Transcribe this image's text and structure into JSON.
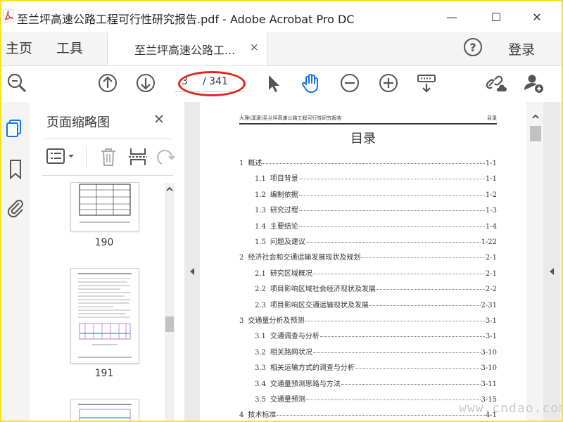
{
  "window": {
    "title": "至兰坪高速公路工程可行性研究报告.pdf - Adobe Acrobat Pro DC",
    "minimize": "—",
    "maximize": "☐",
    "close": "✕"
  },
  "tabs": {
    "home": "主页",
    "tools": "工具",
    "document": "至兰坪高速公路工...",
    "document_close": "×",
    "login": "登录"
  },
  "toolbar": {
    "current_page": "3",
    "page_total": "/ 341"
  },
  "panel": {
    "title": "页面缩略图",
    "close": "✕",
    "thumbnails": [
      {
        "page": "190"
      },
      {
        "page": "191"
      }
    ]
  },
  "document": {
    "header_left": "大理(漾濞)至兰坪高速公路工程可行性研究报告",
    "header_right": "目录",
    "toc_title": "目录",
    "toc": [
      {
        "num": "1",
        "title": "概述",
        "page": "1-1",
        "level": 1
      },
      {
        "num": "1.1",
        "title": "项目背景",
        "page": "1-1",
        "level": 2
      },
      {
        "num": "1.2",
        "title": "编制依据",
        "page": "1-2",
        "level": 2
      },
      {
        "num": "1.3",
        "title": "研究过程",
        "page": "1-3",
        "level": 2
      },
      {
        "num": "1.4",
        "title": "主要结论",
        "page": "1-4",
        "level": 2
      },
      {
        "num": "1.5",
        "title": "问题及建议",
        "page": "1-22",
        "level": 2
      },
      {
        "num": "2",
        "title": "经济社会和交通运输发展现状及规划",
        "page": "2-1",
        "level": 1
      },
      {
        "num": "2.1",
        "title": "研究区域概况",
        "page": "2-1",
        "level": 2
      },
      {
        "num": "2.2",
        "title": "项目影响区域社会经济现状及发展",
        "page": "2-2",
        "level": 2
      },
      {
        "num": "2.3",
        "title": "项目影响区交通运输现状及发展",
        "page": "2-31",
        "level": 2
      },
      {
        "num": "3",
        "title": "交通量分析及预测",
        "page": "3-1",
        "level": 1
      },
      {
        "num": "3.1",
        "title": "交通调查与分析",
        "page": "3-1",
        "level": 2
      },
      {
        "num": "3.2",
        "title": "相关路网状况",
        "page": "3-10",
        "level": 2
      },
      {
        "num": "3.3",
        "title": "相关运输方式的调查与分析",
        "page": "3-10",
        "level": 2
      },
      {
        "num": "3.4",
        "title": "交通量预测思路与方法",
        "page": "3-11",
        "level": 2
      },
      {
        "num": "3.5",
        "title": "交通量预测",
        "page": "3-15",
        "level": 2
      },
      {
        "num": "4",
        "title": "技术标准",
        "page": "4-1",
        "level": 1
      }
    ]
  },
  "watermark": "www.cndao.com",
  "colors": {
    "accent": "#1473e6",
    "annotation_ring": "#e0261e",
    "frame": "#f5e31e"
  }
}
